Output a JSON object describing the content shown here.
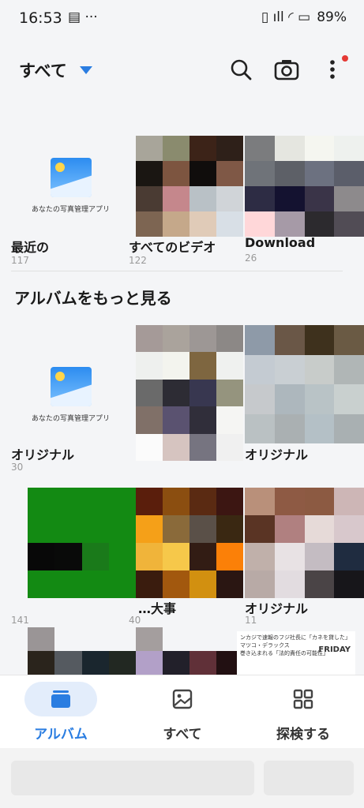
{
  "status": {
    "time": "16:53",
    "left_icons": "▤ ···",
    "battery": "89%",
    "right_icons": "▯ ıll ◜ ▭"
  },
  "topbar": {
    "title": "すべて"
  },
  "albums_row1": [
    {
      "name": "最近の",
      "count": "117",
      "placeholder_caption": "あなたの写真管理アプリ"
    },
    {
      "name": "すべてのビデオ",
      "count": "122"
    },
    {
      "name": "Download",
      "count": "26"
    }
  ],
  "section": {
    "title": "アルバムをもっと見る"
  },
  "albums_row2": [
    {
      "name": "オリジナル",
      "count": "30",
      "placeholder_caption": "あなたの写真管理アプリ"
    },
    {
      "name": "オリジナル",
      "count": ""
    }
  ],
  "albums_row3": [
    {
      "name": "",
      "count": "141"
    },
    {
      "name": "…大事",
      "count": "40"
    },
    {
      "name": "オリジナル",
      "count": "11"
    }
  ],
  "row4_thumb_text": {
    "line1": "ンカジで速報のフジ社長に「カネを貸した」マツコ・デラックス",
    "line2": "巻き込まれる「法的責任の可能性」",
    "brand": "FRIDAY"
  },
  "nav": {
    "albums": "アルバム",
    "all": "すべて",
    "explore": "探検する"
  },
  "colors": {
    "accent": "#2a7de1",
    "nav_pill": "#e3edfb"
  }
}
